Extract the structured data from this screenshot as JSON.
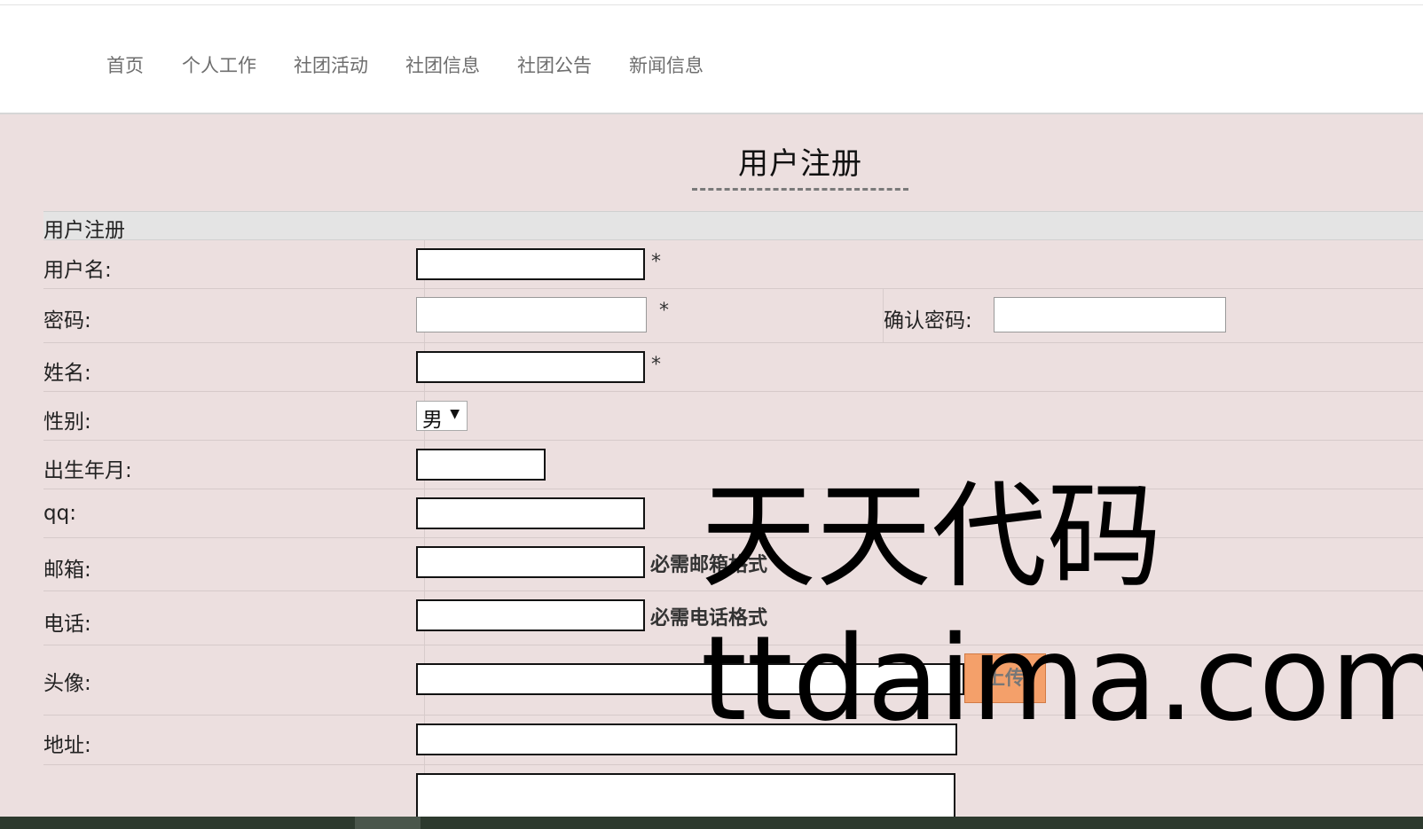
{
  "nav": {
    "items": [
      "首页",
      "个人工作",
      "社团活动",
      "社团信息",
      "社团公告",
      "新闻信息"
    ]
  },
  "page": {
    "title": "用户注册"
  },
  "form": {
    "caption": "用户注册",
    "username_label": "用户名:",
    "password_label": "密码:",
    "confirm_password_label": "确认密码:",
    "name_label": "姓名:",
    "gender_label": "性别:",
    "gender_value": "男",
    "birth_label": "出生年月:",
    "qq_label": "qq:",
    "email_label": "邮箱:",
    "email_hint": "必需邮箱格式",
    "phone_label": "电话:",
    "phone_hint": "必需电话格式",
    "avatar_label": "头像:",
    "upload_label": "上传",
    "address_label": "地址:",
    "required_mark": "*"
  },
  "watermark": {
    "line1": "天天代码",
    "line2": "ttdaima.com"
  },
  "colors": {
    "page_bg": "#ecdfdf",
    "upload_btn": "#f4a06a",
    "nav_text": "#6e6e6e"
  }
}
